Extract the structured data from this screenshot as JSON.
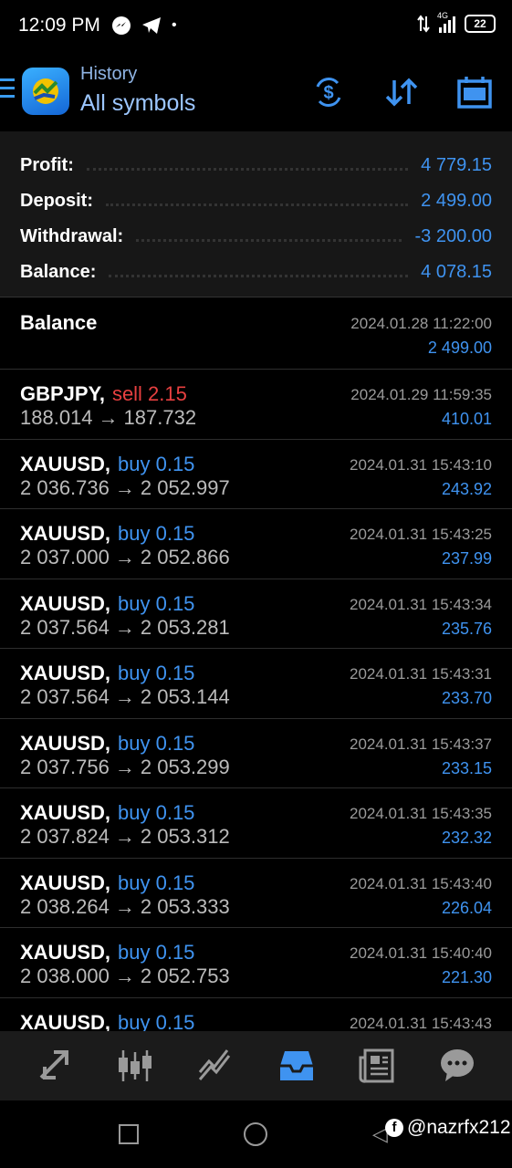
{
  "status": {
    "time": "12:09 PM",
    "network": "4G",
    "battery": "22"
  },
  "header": {
    "section": "History",
    "filter": "All symbols"
  },
  "summary": [
    {
      "label": "Profit:",
      "value": "4 779.15"
    },
    {
      "label": "Deposit:",
      "value": "2 499.00"
    },
    {
      "label": "Withdrawal:",
      "value": "-3 200.00"
    },
    {
      "label": "Balance:",
      "value": "4 078.15"
    }
  ],
  "balance_entry": {
    "label": "Balance",
    "date": "2024.01.28 11:22:00",
    "amount": "2 499.00"
  },
  "deals": [
    {
      "symbol": "GBPJPY,",
      "side": "sell 2.15",
      "type": "sell",
      "open": "188.014",
      "close": "187.732",
      "date": "2024.01.29 11:59:35",
      "profit": "410.01"
    },
    {
      "symbol": "XAUUSD,",
      "side": "buy 0.15",
      "type": "buy",
      "open": "2 036.736",
      "close": "2 052.997",
      "date": "2024.01.31 15:43:10",
      "profit": "243.92"
    },
    {
      "symbol": "XAUUSD,",
      "side": "buy 0.15",
      "type": "buy",
      "open": "2 037.000",
      "close": "2 052.866",
      "date": "2024.01.31 15:43:25",
      "profit": "237.99"
    },
    {
      "symbol": "XAUUSD,",
      "side": "buy 0.15",
      "type": "buy",
      "open": "2 037.564",
      "close": "2 053.281",
      "date": "2024.01.31 15:43:34",
      "profit": "235.76"
    },
    {
      "symbol": "XAUUSD,",
      "side": "buy 0.15",
      "type": "buy",
      "open": "2 037.564",
      "close": "2 053.144",
      "date": "2024.01.31 15:43:31",
      "profit": "233.70"
    },
    {
      "symbol": "XAUUSD,",
      "side": "buy 0.15",
      "type": "buy",
      "open": "2 037.756",
      "close": "2 053.299",
      "date": "2024.01.31 15:43:37",
      "profit": "233.15"
    },
    {
      "symbol": "XAUUSD,",
      "side": "buy 0.15",
      "type": "buy",
      "open": "2 037.824",
      "close": "2 053.312",
      "date": "2024.01.31 15:43:35",
      "profit": "232.32"
    },
    {
      "symbol": "XAUUSD,",
      "side": "buy 0.15",
      "type": "buy",
      "open": "2 038.264",
      "close": "2 053.333",
      "date": "2024.01.31 15:43:40",
      "profit": "226.04"
    },
    {
      "symbol": "XAUUSD,",
      "side": "buy 0.15",
      "type": "buy",
      "open": "2 038.000",
      "close": "2 052.753",
      "date": "2024.01.31 15:40:40",
      "profit": "221.30"
    },
    {
      "symbol": "XAUUSD,",
      "side": "buy 0.15",
      "type": "buy",
      "open": "",
      "close": "",
      "date": "2024.01.31 15:43:43",
      "profit": ""
    }
  ],
  "arrow_glyph": "→",
  "watermark": "@nazrfx212",
  "colors": {
    "accent": "#3f93f0",
    "sell": "#e74040",
    "summary_bg": "#171717",
    "nav_bg": "#1b1b1b"
  }
}
